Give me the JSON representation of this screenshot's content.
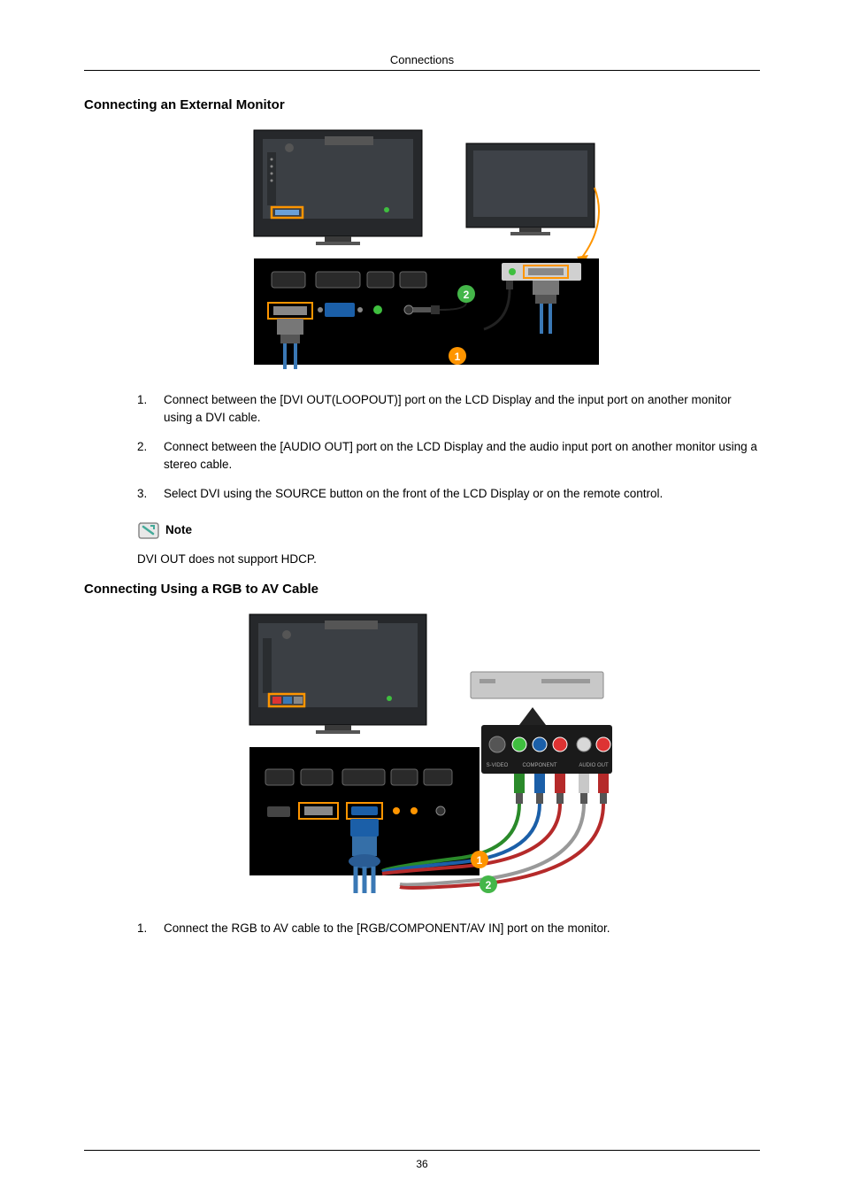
{
  "header": {
    "title": "Connections"
  },
  "section1": {
    "title": "Connecting an External Monitor",
    "steps": [
      {
        "num": "1.",
        "text": "Connect between the [DVI OUT(LOOPOUT)] port on the LCD Display and the input port on another monitor using a DVI cable."
      },
      {
        "num": "2.",
        "text": "Connect between the [AUDIO OUT] port on the LCD Display and the audio input port on another monitor using a stereo cable."
      },
      {
        "num": "3.",
        "text": "Select DVI using the SOURCE button on the front of the LCD Display or on the remote control."
      }
    ],
    "note_label": "Note",
    "note_text": "DVI OUT does not support HDCP.",
    "callout1": "1",
    "callout2": "2"
  },
  "section2": {
    "title": "Connecting Using a RGB to AV Cable",
    "steps": [
      {
        "num": "1.",
        "text": "Connect the RGB to AV cable to the [RGB/COMPONENT/AV IN] port on the monitor."
      }
    ],
    "callout1": "1",
    "callout2": "2",
    "labels": {
      "svideo": "S-VIDEO",
      "component": "COMPONENT",
      "audioout": "AUDIO OUT"
    }
  },
  "page_number": "36"
}
